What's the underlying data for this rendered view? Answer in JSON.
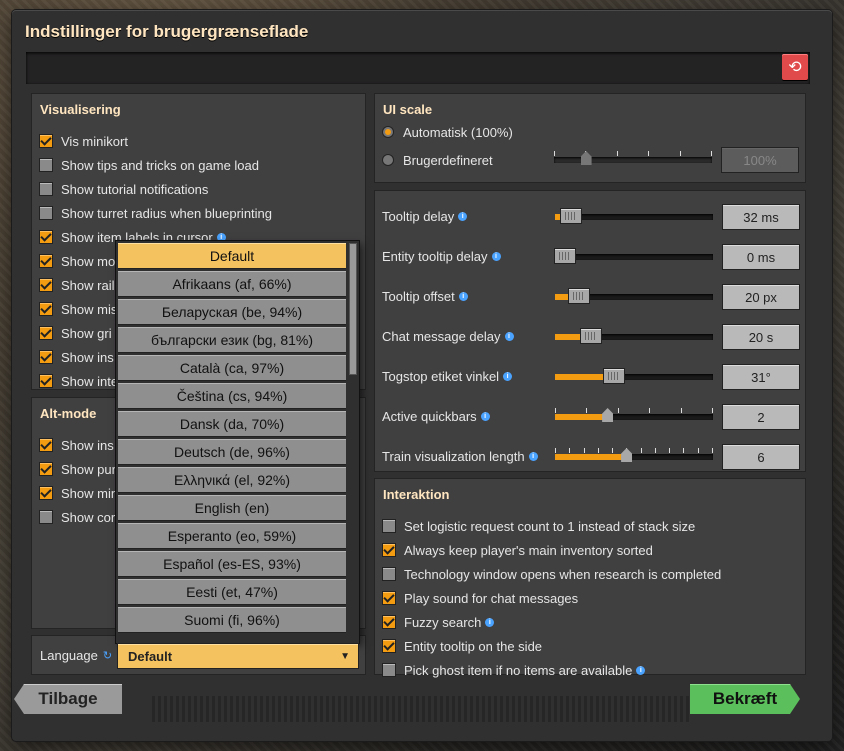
{
  "title": "Indstillinger for brugergrænseflade",
  "visualisering": {
    "title": "Visualisering",
    "items": [
      {
        "label": "Vis minikort",
        "checked": true,
        "info": false
      },
      {
        "label": "Show tips and tricks on game load",
        "checked": false,
        "info": false
      },
      {
        "label": "Show tutorial notifications",
        "checked": false,
        "info": false
      },
      {
        "label": "Show turret radius when blueprinting",
        "checked": false,
        "info": false
      },
      {
        "label": "Show item labels in cursor",
        "checked": true,
        "info": true
      },
      {
        "label": "Show mo",
        "checked": true,
        "info": false
      },
      {
        "label": "Show rail",
        "checked": true,
        "info": false
      },
      {
        "label": "Show mis",
        "checked": true,
        "info": false
      },
      {
        "label": "Show gri",
        "checked": true,
        "info": false
      },
      {
        "label": "Show ins",
        "checked": true,
        "info": false
      },
      {
        "label": "Show inte",
        "checked": true,
        "info": false
      }
    ]
  },
  "altmode": {
    "title": "Alt-mode",
    "items": [
      {
        "label": "Show ins",
        "checked": true
      },
      {
        "label": "Show pur",
        "checked": true
      },
      {
        "label": "Show min",
        "checked": true
      },
      {
        "label": "Show cor",
        "checked": false
      }
    ]
  },
  "language": {
    "label": "Language",
    "selected": "Default",
    "options": [
      "Default",
      "Afrikaans (af, 66%)",
      "Беларуская (be, 94%)",
      "български език (bg, 81%)",
      "Català (ca, 97%)",
      "Čeština (cs, 94%)",
      "Dansk (da, 70%)",
      "Deutsch (de, 96%)",
      "Ελληνικά (el, 92%)",
      "English (en)",
      "Esperanto (eo, 59%)",
      "Español (es-ES, 93%)",
      "Eesti (et, 47%)",
      "Suomi (fi, 96%)"
    ]
  },
  "ui_scale": {
    "title": "UI scale",
    "auto_label": "Automatisk (100%)",
    "custom_label": "Brugerdefineret",
    "custom_value": "100%",
    "custom_level": 0.2
  },
  "sliders": [
    {
      "label": "Tooltip delay",
      "value": "32 ms",
      "level": 0.05,
      "ticks": 0
    },
    {
      "label": "Entity tooltip delay",
      "value": "0 ms",
      "level": 0.0,
      "ticks": 0
    },
    {
      "label": "Tooltip offset",
      "value": "20 px",
      "level": 0.1,
      "ticks": 0
    },
    {
      "label": "Chat message delay",
      "value": "20 s",
      "level": 0.18,
      "ticks": 0
    },
    {
      "label": "Togstop etiket vinkel",
      "value": "31°",
      "level": 0.32,
      "ticks": 0
    },
    {
      "label": "Active quickbars",
      "value": "2",
      "level": 0.33,
      "ticks": 6
    },
    {
      "label": "Train visualization length",
      "value": "6",
      "level": 0.45,
      "ticks": 12
    }
  ],
  "interaktion": {
    "title": "Interaktion",
    "items": [
      {
        "label": "Set logistic request count to 1 instead of stack size",
        "checked": false,
        "info": false
      },
      {
        "label": "Always keep player's main inventory sorted",
        "checked": true,
        "info": false
      },
      {
        "label": "Technology window opens when research is completed",
        "checked": false,
        "info": false
      },
      {
        "label": "Play sound for chat messages",
        "checked": true,
        "info": false
      },
      {
        "label": "Fuzzy search",
        "checked": true,
        "info": true
      },
      {
        "label": "Entity tooltip on the side",
        "checked": true,
        "info": false
      },
      {
        "label": "Pick ghost item if no items are available",
        "checked": false,
        "info": true
      }
    ]
  },
  "buttons": {
    "back": "Tilbage",
    "confirm": "Bekræft"
  },
  "colors": {
    "accent": "#f39c12",
    "title": "#ffe6c0",
    "confirm": "#5bc05b",
    "reset": "#e04a4a"
  },
  "icons": {
    "reset": "reset-icon",
    "info": "info-icon",
    "dropdown": "chevron-down-icon"
  }
}
